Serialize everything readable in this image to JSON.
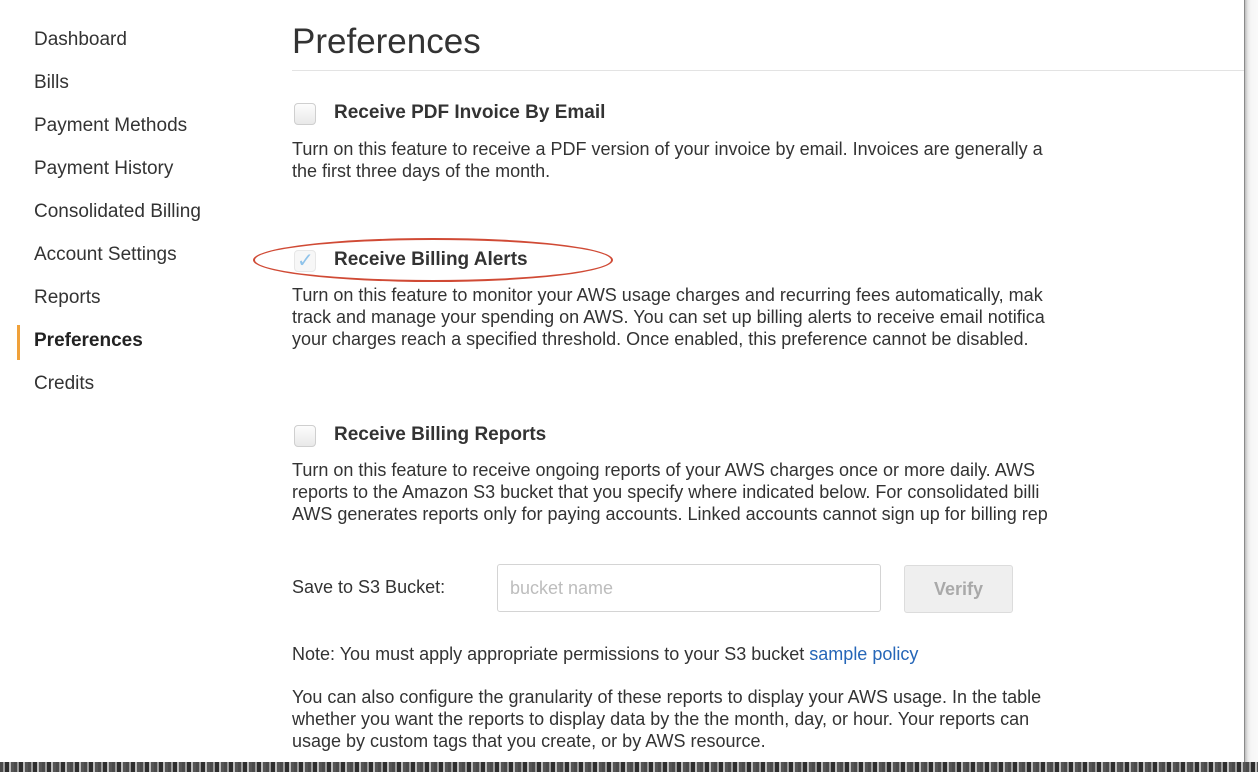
{
  "sidebar": {
    "items": [
      {
        "label": "Dashboard"
      },
      {
        "label": "Bills"
      },
      {
        "label": "Payment Methods"
      },
      {
        "label": "Payment History"
      },
      {
        "label": "Consolidated Billing"
      },
      {
        "label": "Account Settings"
      },
      {
        "label": "Reports"
      },
      {
        "label": "Preferences",
        "active": true
      },
      {
        "label": "Credits"
      }
    ]
  },
  "main": {
    "title": "Preferences",
    "preferences": [
      {
        "label": "Receive PDF Invoice By Email",
        "checked": false,
        "description": [
          "Turn on this feature to receive a PDF version of your invoice by email. Invoices are generally a",
          "the first three days of the month."
        ]
      },
      {
        "label": "Receive Billing Alerts",
        "checked": true,
        "check_glyph": "✓",
        "description": [
          "Turn on this feature to monitor your AWS usage charges and recurring fees automatically, mak",
          "track and manage your spending on AWS. You can set up billing alerts to receive email notifica",
          "your charges reach a specified threshold. Once enabled, this preference cannot be disabled."
        ]
      },
      {
        "label": "Receive Billing Reports",
        "checked": false,
        "description": [
          "Turn on this feature to receive ongoing reports of your AWS charges once or more daily. AWS",
          "reports to the Amazon S3 bucket that you specify where indicated below. For consolidated billi",
          "AWS generates reports only for paying accounts. Linked accounts cannot sign up for billing rep"
        ]
      }
    ],
    "s3": {
      "label": "Save to S3 Bucket:",
      "placeholder": "bucket name",
      "value": "",
      "verify_label": "Verify"
    },
    "note": {
      "text": "Note: You must apply appropriate permissions to your S3 bucket ",
      "link": "sample policy"
    },
    "granularity": [
      "You can also configure the granularity of these reports to display your AWS usage. In the table",
      "whether you want the reports to display data by the the month, day, or hour. Your reports can",
      "usage by custom tags that you create, or by AWS resource."
    ]
  },
  "colors": {
    "accent": "#f0a13a",
    "link": "#2566b8",
    "highlight_oval": "#d04a35"
  }
}
